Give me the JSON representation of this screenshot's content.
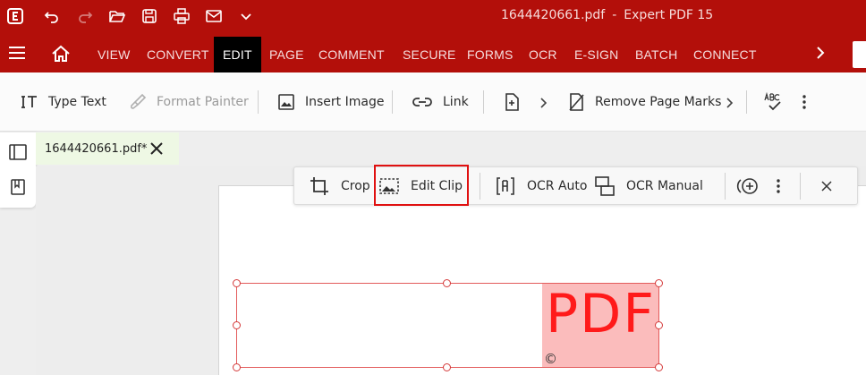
{
  "window": {
    "file_name": "1644420661.pdf",
    "separator": "-",
    "app_name": "Expert PDF 15"
  },
  "quick_access": {
    "icons": [
      "app-logo-icon",
      "undo-icon",
      "redo-icon",
      "open-folder-icon",
      "save-icon",
      "print-icon",
      "email-icon",
      "chevron-down-icon"
    ]
  },
  "menu": {
    "tabs": [
      {
        "label": "VIEW"
      },
      {
        "label": "CONVERT"
      },
      {
        "label": "EDIT",
        "active": true
      },
      {
        "label": "PAGE"
      },
      {
        "label": "COMMENT"
      },
      {
        "label": "SECURE"
      },
      {
        "label": "FORMS"
      },
      {
        "label": "OCR"
      },
      {
        "label": "E-SIGN"
      },
      {
        "label": "BATCH"
      },
      {
        "label": "CONNECT"
      }
    ]
  },
  "ribbon": {
    "type_text": "Type Text",
    "format_painter": "Format Painter",
    "insert_image": "Insert Image",
    "link": "Link",
    "remove_page_marks": "Remove Page Marks"
  },
  "document_tab": {
    "label": "1644420661.pdf*"
  },
  "image_toolbar": {
    "crop": "Crop",
    "edit_clip": "Edit Clip",
    "ocr_auto": "OCR Auto",
    "ocr_manual": "OCR Manual"
  },
  "page_image": {
    "text": "PDF",
    "mark": "©"
  },
  "colors": {
    "brand": "#b30f0a",
    "highlight": "#e01010",
    "image_bg": "#fbbcbc",
    "image_text": "#ff1a1a"
  }
}
